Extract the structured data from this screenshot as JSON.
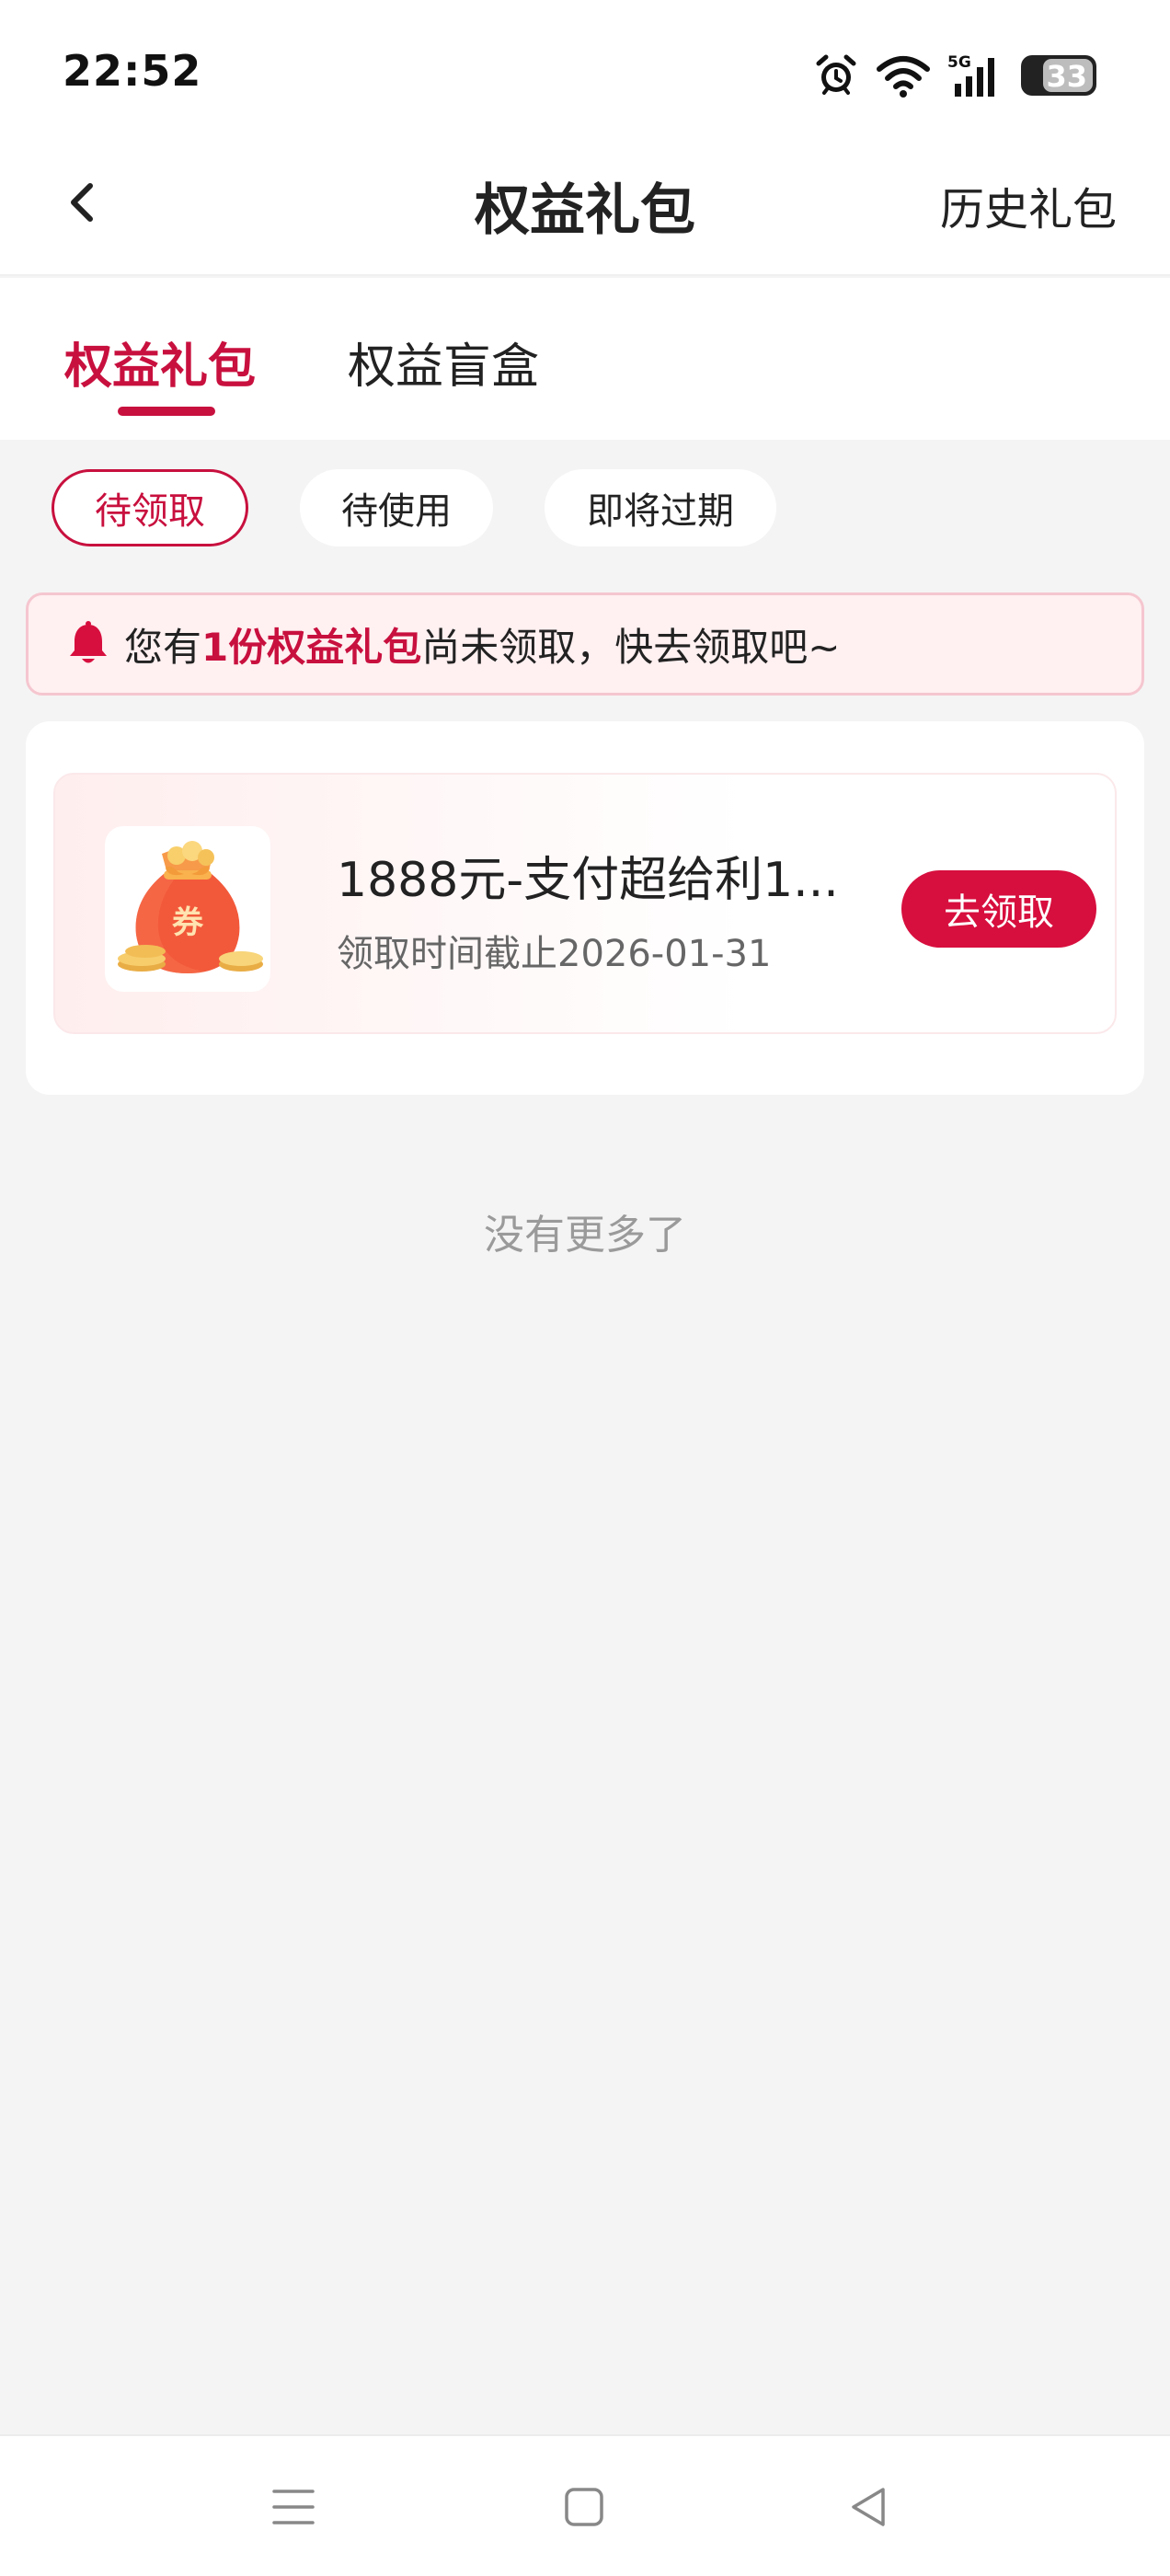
{
  "status_bar": {
    "time": "22:52",
    "battery": "33",
    "network": "5G",
    "icons": [
      "alarm-icon",
      "wifi-icon",
      "signal-5g-icon",
      "battery-icon"
    ]
  },
  "nav": {
    "title": "权益礼包",
    "history_label": "历史礼包",
    "back_icon": "chevron-left-icon"
  },
  "tabs": [
    {
      "label": "权益礼包",
      "active": true
    },
    {
      "label": "权益盲盒",
      "active": false
    }
  ],
  "filters": [
    {
      "label": "待领取",
      "active": true
    },
    {
      "label": "待使用",
      "active": false
    },
    {
      "label": "即将过期",
      "active": false
    }
  ],
  "notice": {
    "prefix": "您有",
    "highlight": "1份权益礼包",
    "suffix": "尚未领取，快去领取吧~",
    "icon": "bell-icon"
  },
  "gift_card": {
    "title": "1888元-支付超给利1...",
    "subtitle": "领取时间截止2026-01-31",
    "button_label": "去领取",
    "icon": "coupon-bag-icon",
    "icon_badge": "券"
  },
  "list_footer": "没有更多了",
  "colors": {
    "accent": "#c8103e",
    "button": "#d70f3e",
    "background": "#f4f4f4",
    "notice_bg": "#fff0f1"
  },
  "system_nav": [
    "menu-icon",
    "home-square-icon",
    "back-triangle-icon"
  ]
}
